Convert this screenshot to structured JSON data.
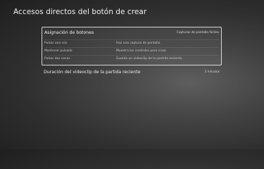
{
  "page": {
    "title": "Accesos directos del botón de crear"
  },
  "button_assignment": {
    "label": "Asignación de botones",
    "value": "Capturas de pantalla fáciles",
    "rows": [
      {
        "action": "Pulsar una vez",
        "result": "Haz una captura de pantalla."
      },
      {
        "action": "Mantener pulsado",
        "result": "Muestra los controles para crear."
      },
      {
        "action": "Pulsar dos veces",
        "result": "Guarda un videoclip de tu partida reciente."
      }
    ]
  },
  "clip_duration": {
    "label": "Duración del videoclip de la partida reciente",
    "value": "3 minutos"
  },
  "colors": {
    "background": "#2f2f2f",
    "text": "#eaeaea",
    "focus_border": "#ebebeb"
  }
}
